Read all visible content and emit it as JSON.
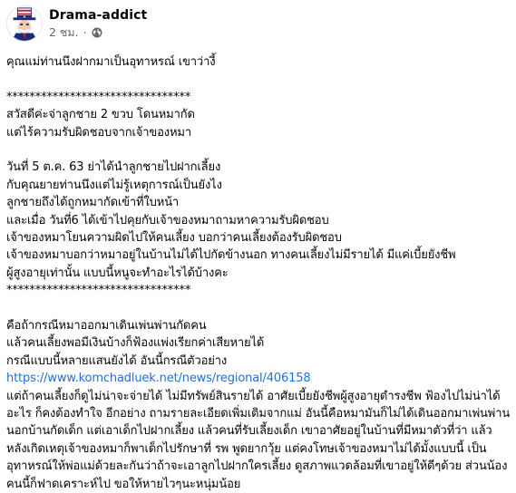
{
  "post": {
    "author": "Drama-addict",
    "time": "2 ชม.",
    "separator": "·",
    "privacy_icon": "globe-icon",
    "avatar_icon": "uncle-sam-avatar"
  },
  "content": {
    "intro": "คุณแม่ท่านนึงฝากมาเป็นอุทาหรณ์ เขาว่างี้",
    "divider": "********************************",
    "quote": [
      "สวัสดีค่ะจ่าลูกชาย 2 ขวบ โดนหมากัด",
      "แต่ไร้ความรับผิดชอบจากเจ้าของหมา"
    ],
    "story": [
      "วันที่ 5 ต.ค. 63 ย่าได้นำลูกชายไปฝากเลี้ยง",
      "กับคุณยายท่านนึงแต่ไม่รู้เหตุการณ์เป็นยังไง",
      "ลูกชายถึงได้ถูกหมากัดเข้าที่ใบหน้า",
      "และเมื่อ วันที่6 ได้เข้าไปคุยกับเจ้าของหมาถามหาความรับผิดชอบ",
      "เจ้าของหมาโยนความผิดไปให้คนเลี้ยง บอกว่าคนเลี้ยงต้องรับผิดชอบ",
      "เจ้าของหมาบอกว่าหมาอยู่ในบ้านไม่ได้ไปกัดข้างนอก ทางคนเลี้ยงไม่มีรายได้ มีแค่เบี้ยยังชีพ",
      "ผู้สูงอายุเท่านั้น แบบนี้หนูจะทำอะไรได้บ้างคะ"
    ],
    "divider2": "********************************",
    "commentary": [
      "คือถ้ากรณีหมาออกมาเดินเพ่นพ่านกัดคน",
      "แล้วคนเลี้ยงพอมีเงินบ้างก็ฟ้องแพ่งเรียกค่าเสียหายได้",
      "กรณีแบบนี้หลายแสนยังได้  อันนี้กรณีตัวอย่าง"
    ],
    "link": "https://www.komchadluek.net/news/regional/406158",
    "closing": "แต่ถ้าคนเลี้ยงก็ดูไม่น่าจะจ่ายได้ ไม่มีทรัพย์สินรายได้ อาศัยเบี้ยยังชีพผู้สูงอายุดำรงชีพ ฟ้องไปไม่น่าได้อะไร ก็คงต้องทำใจ อีกอย่าง ถามรายละเอียดเพิ่มเติมจากแม่ อันนี้คือหมามันก็ไม่ได้เดินออกมาเพ่นพ่านนอกบ้านกัดเด็ก แต่เอาเด็กไปฝากเลี้ยง แล้วคนที่รับเลี้ยงเด็ก เขาอาศัยอยู่ในบ้านที่มีหมาตัวที่ว่า แล้วหลังเกิดเหตุเจ้าของหมาก็พาเด็กไปรักษาที่ รพ  พูดยากวุ้ย แต่คงโทษเจ้าของหมาไม่ได้มั้งแบบนี้ เป็นอุทาหรณ์ให้พ่อแม่ด้วยละกันว่าถ้าจะเอาลูกไปฝากใครเลี้ยง ดูสภาพแวดล้อมที่เขาอยู่ให้ดีๆด้วย ส่วนน้องคนนี้ก็ฟาดเคราะห์ไป ขอให้หายไวๆนะหนุ่มน้อย"
  },
  "colors": {
    "text": "#050505",
    "meta": "#65676b",
    "link": "#216fdb"
  }
}
